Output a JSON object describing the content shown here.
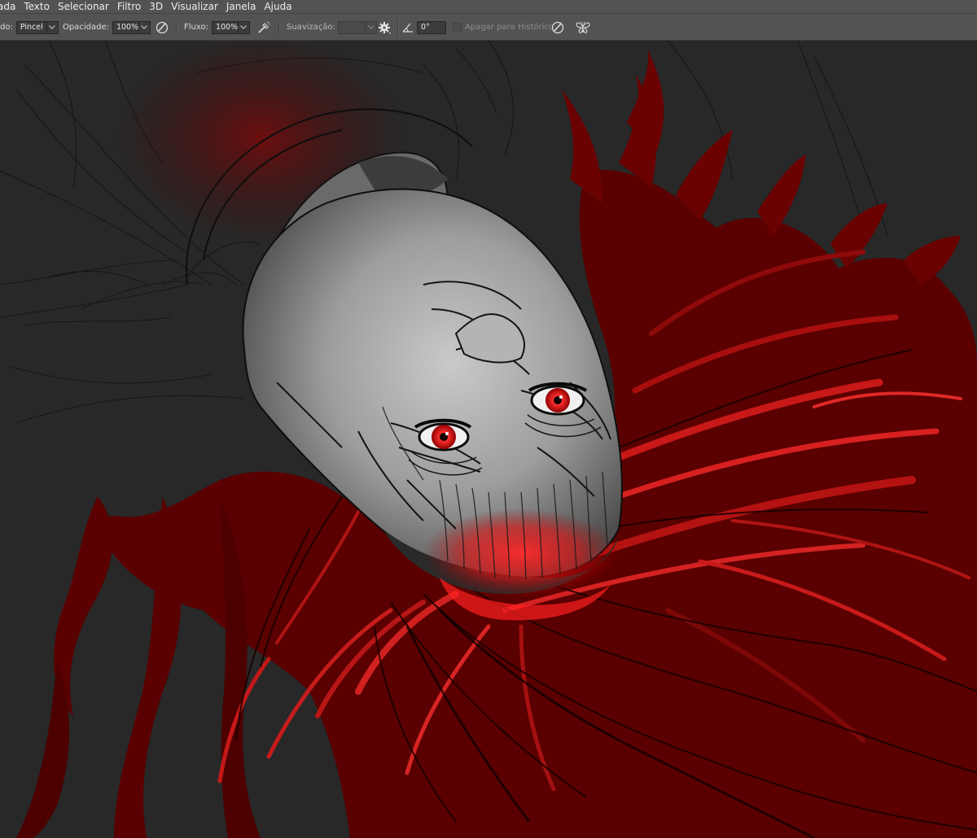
{
  "menubar": {
    "items": [
      "ada",
      "Texto",
      "Selecionar",
      "Filtro",
      "3D",
      "Visualizar",
      "Janela",
      "Ajuda"
    ]
  },
  "options": {
    "mode_label": "do:",
    "mode_value": "Pincel",
    "opacity_label": "Opacidade:",
    "opacity_value": "100%",
    "flow_label": "Fluxo:",
    "flow_value": "100%",
    "smoothing_label": "Suavização:",
    "smoothing_value": "",
    "angle_value": "0°",
    "erase_history_label": "Apagar para Histórico",
    "erase_history_checked": false
  },
  "icons": {
    "pressure_opacity": "pen-pressure-icon",
    "airbrush": "airbrush-icon",
    "settings": "gear-icon",
    "angle": "angle-icon",
    "pressure_size": "pen-pressure-icon",
    "symmetry": "butterfly-icon"
  },
  "colors": {
    "toolbar_bg": "#535353",
    "canvas_bg": "#282828",
    "hair_dark": "#5a0000",
    "hair_bright": "#d82020",
    "eye_red": "#ff2a2a"
  }
}
